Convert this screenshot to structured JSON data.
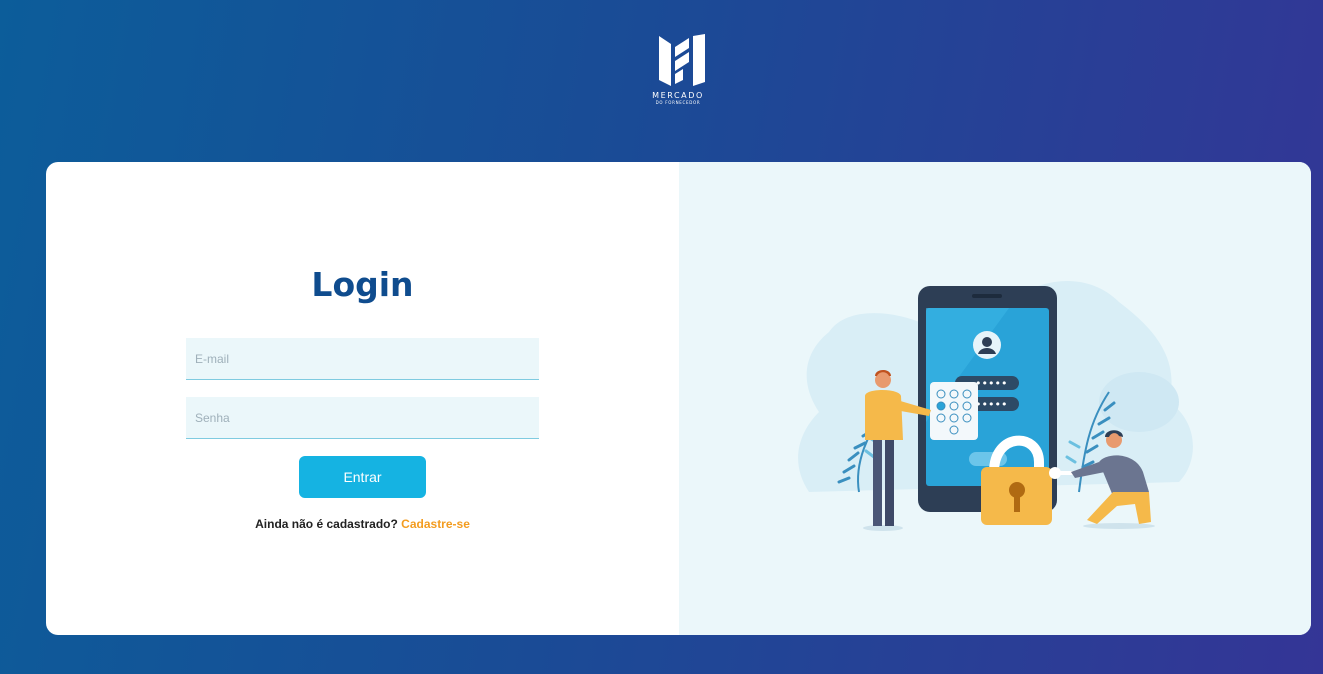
{
  "brand": {
    "wordmark": "MERCADO",
    "subword": "DO FORNECEDOR",
    "logo_icon": "mf-monogram-logo"
  },
  "login": {
    "title": "Login",
    "email_placeholder": "E-mail",
    "password_placeholder": "Senha",
    "submit_label": "Entrar",
    "signup_prompt": "Ainda não é cadastrado?",
    "signup_link": "Cadastre-se"
  },
  "illustration": {
    "name": "mobile-security-illustration",
    "password_mask": "•••••"
  },
  "colors": {
    "background_start": "#0c5d9a",
    "background_end": "#343596",
    "title": "#0f4c8e",
    "button": "#15b3e2",
    "link": "#f39c1f",
    "field_bg": "#ebf7fa",
    "panel_bg": "#ebf7fa"
  }
}
